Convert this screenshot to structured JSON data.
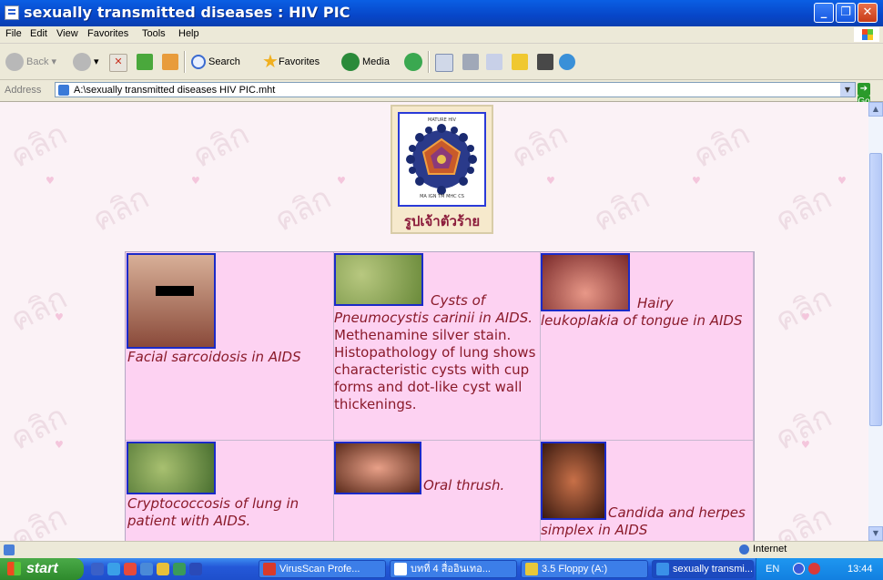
{
  "window": {
    "title": "sexually transmitted diseases : HIV PIC",
    "minimize_label": "_",
    "maximize_label": "❐",
    "close_label": "✕"
  },
  "menu": [
    "File",
    "Edit",
    "View",
    "Favorites",
    "Tools",
    "Help"
  ],
  "toolbar": {
    "back_label": "Back",
    "search_label": "Search",
    "favorites_label": "Favorites",
    "media_label": "Media"
  },
  "address": {
    "label": "Address",
    "value": "A:\\sexually transmitted diseases  HIV PIC.mht",
    "go_label": "Go"
  },
  "page": {
    "hero": {
      "image_title": "MATURE HIV",
      "image_legend": "MA  IGN  TM  MHC  CS",
      "caption": "รูปเจ้าตัวร้าย"
    },
    "gallery": [
      {
        "caption": "Facial sarcoidosis in AIDS",
        "extra": ""
      },
      {
        "caption": "Cysts of Pneumocystis carinii in AIDS.",
        "extra": "Methenamine silver stain. Histopathology of lung shows characteristic cysts with cup forms and dot-like cyst wall thickenings."
      },
      {
        "caption": "Hairy leukoplakia of tongue in AIDS",
        "extra": ""
      },
      {
        "caption": "Cryptococcosis of lung in patient with AIDS.",
        "extra": ""
      },
      {
        "caption": "Oral thrush.",
        "extra": ""
      },
      {
        "caption": "Candida and herpes simplex in AIDS",
        "extra": ""
      }
    ]
  },
  "status": {
    "zone": "Internet"
  },
  "taskbar": {
    "start_label": "start",
    "tasks": [
      "VirusScan Profe...",
      "บทที่ 4 สื่ออินเทอ...",
      "3.5 Floppy (A:)",
      "sexually transmi..."
    ],
    "language": "EN",
    "clock": "13:44"
  },
  "colors": {
    "gallery_bg": "#fdd2f2",
    "caption_text": "#8a1a2a",
    "thumbnail_border": "#1a2ac8"
  }
}
